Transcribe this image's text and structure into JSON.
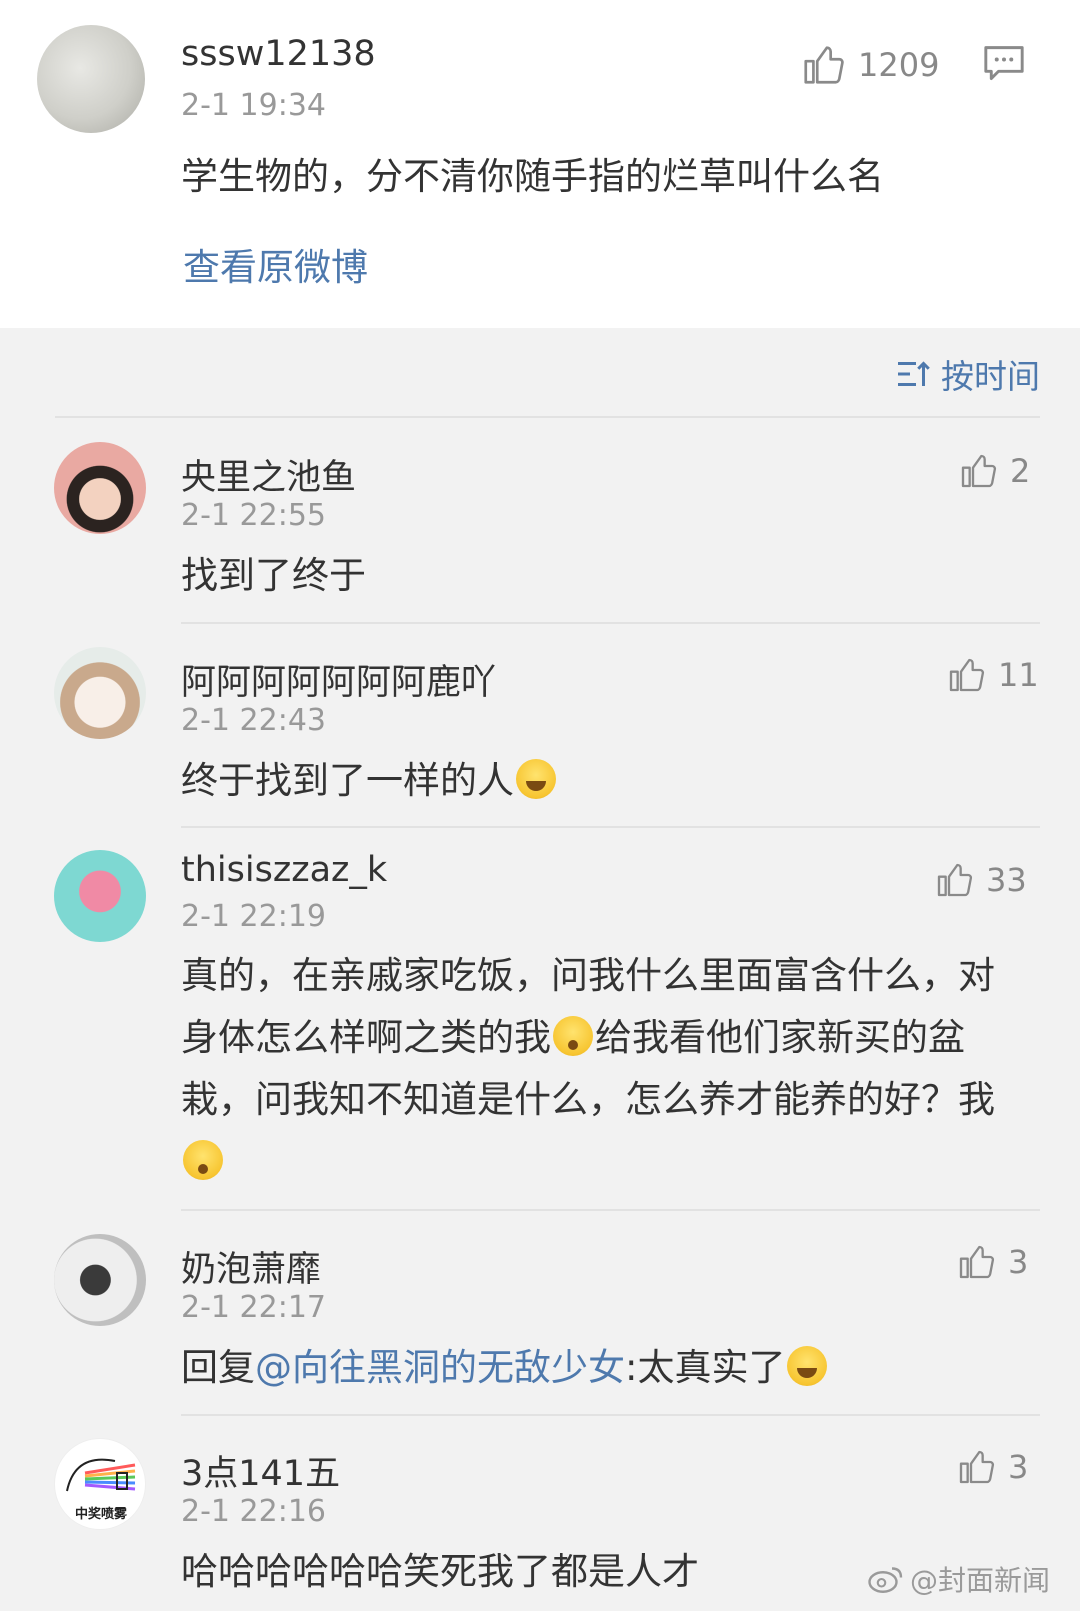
{
  "post": {
    "username": "sssw12138",
    "time": "2-1 19:34",
    "likes": "1209",
    "text": "学生物的，分不清你随手指的烂草叫什么名",
    "view_original": "查看原微博"
  },
  "sort": {
    "label": "按时间"
  },
  "comments": [
    {
      "username": "央里之池鱼",
      "time": "2-1 22:55",
      "likes": "2",
      "text": "找到了终于"
    },
    {
      "username": "阿阿阿阿阿阿阿鹿吖",
      "time": "2-1 22:43",
      "likes": "11",
      "text": "终于找到了一样的人"
    },
    {
      "username": "thisiszzaz_k",
      "time": "2-1 22:19",
      "likes": "33",
      "text_parts": [
        "真的，在亲戚家吃饭，问我什么里面富含什么，对身体怎么样啊之类的我",
        "给我看他们家新买的盆栽，问我知不知道是什么，怎么养才能养的好？我"
      ]
    },
    {
      "username": "奶泡萧靡",
      "time": "2-1 22:17",
      "likes": "3",
      "reply_prefix": "回复",
      "mention": "@向往黑洞的无敌少女",
      "reply_text": ":太真实了"
    },
    {
      "username": "3点141五",
      "time": "2-1 22:16",
      "likes": "3",
      "text": "哈哈哈哈哈哈笑死我了都是人才",
      "avatar_text": "中奖喷雾"
    }
  ],
  "watermark": "@封面新闻",
  "colors": {
    "link": "#4e79ad",
    "muted": "#999999",
    "background": "#f2f2f2"
  }
}
